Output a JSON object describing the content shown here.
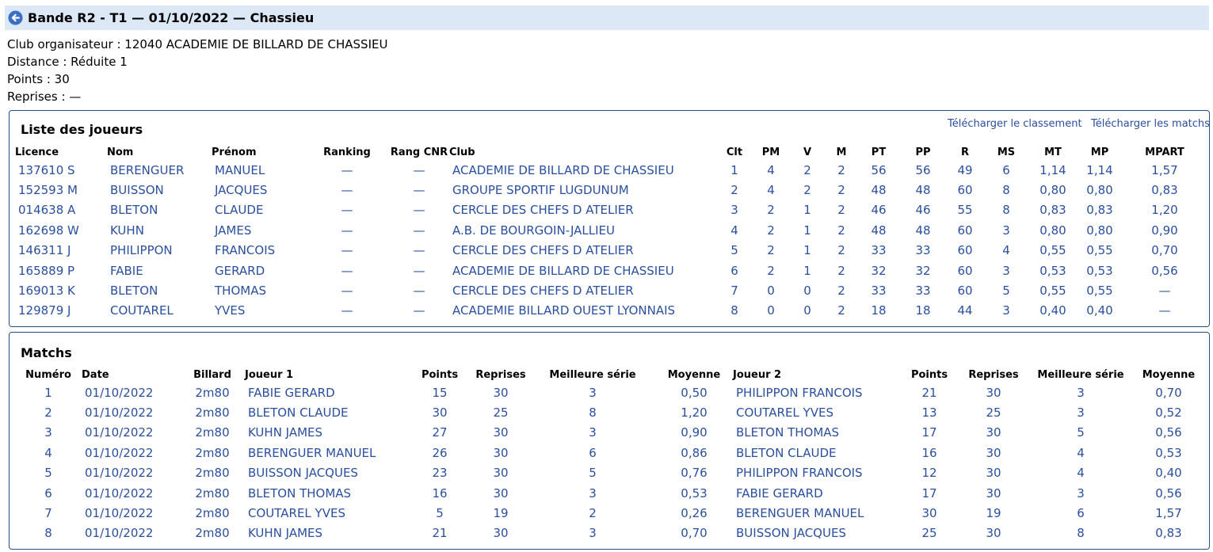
{
  "header": {
    "title": "Bande R2 - T1 — 01/10/2022 — Chassieu"
  },
  "info": {
    "club": "Club organisateur : 12040 ACADEMIE DE BILLARD DE CHASSIEU",
    "distance": "Distance : Réduite 1",
    "points": "Points : 30",
    "reprises": "Reprises : —"
  },
  "players": {
    "title": "Liste des joueurs",
    "download_ranking": "Télécharger le classement",
    "download_matches": "Télécharger les matchs",
    "columns": [
      "Licence",
      "Nom",
      "Prénom",
      "Ranking",
      "Rang CNR",
      "Club",
      "Clt",
      "PM",
      "V",
      "M",
      "PT",
      "PP",
      "R",
      "MS",
      "MT",
      "MP",
      "MPART"
    ],
    "rows": [
      [
        "137610 S",
        "BERENGUER",
        "MANUEL",
        "—",
        "—",
        "ACADEMIE DE BILLARD DE CHASSIEU",
        "1",
        "4",
        "2",
        "2",
        "56",
        "56",
        "49",
        "6",
        "1,14",
        "1,14",
        "1,57"
      ],
      [
        "152593 M",
        "BUISSON",
        "JACQUES",
        "—",
        "—",
        "GROUPE SPORTIF LUGDUNUM",
        "2",
        "4",
        "2",
        "2",
        "48",
        "48",
        "60",
        "8",
        "0,80",
        "0,80",
        "0,83"
      ],
      [
        "014638 A",
        "BLETON",
        "CLAUDE",
        "—",
        "—",
        "CERCLE DES CHEFS D ATELIER",
        "3",
        "2",
        "1",
        "2",
        "46",
        "46",
        "55",
        "8",
        "0,83",
        "0,83",
        "1,20"
      ],
      [
        "162698 W",
        "KUHN",
        "JAMES",
        "—",
        "—",
        "A.B. DE BOURGOIN-JALLIEU",
        "4",
        "2",
        "1",
        "2",
        "48",
        "48",
        "60",
        "3",
        "0,80",
        "0,80",
        "0,90"
      ],
      [
        "146311 J",
        "PHILIPPON",
        "FRANCOIS",
        "—",
        "—",
        "CERCLE DES CHEFS D ATELIER",
        "5",
        "2",
        "1",
        "2",
        "33",
        "33",
        "60",
        "4",
        "0,55",
        "0,55",
        "0,70"
      ],
      [
        "165889 P",
        "FABIE",
        "GERARD",
        "—",
        "—",
        "ACADEMIE DE BILLARD DE CHASSIEU",
        "6",
        "2",
        "1",
        "2",
        "32",
        "32",
        "60",
        "3",
        "0,53",
        "0,53",
        "0,56"
      ],
      [
        "169013 K",
        "BLETON",
        "THOMAS",
        "—",
        "—",
        "CERCLE DES CHEFS D ATELIER",
        "7",
        "0",
        "0",
        "2",
        "33",
        "33",
        "60",
        "5",
        "0,55",
        "0,55",
        "—"
      ],
      [
        "129879 J",
        "COUTAREL",
        "YVES",
        "—",
        "—",
        "ACADEMIE BILLARD OUEST LYONNAIS",
        "8",
        "0",
        "0",
        "2",
        "18",
        "18",
        "44",
        "3",
        "0,40",
        "0,40",
        "—"
      ]
    ]
  },
  "matches": {
    "title": "Matchs",
    "columns": [
      "Numéro",
      "Date",
      "Billard",
      "Joueur 1",
      "Points",
      "Reprises",
      "Meilleure série",
      "Moyenne",
      "Joueur 2",
      "Points",
      "Reprises",
      "Meilleure série",
      "Moyenne"
    ],
    "rows": [
      [
        "1",
        "01/10/2022",
        "2m80",
        "FABIE GERARD",
        "15",
        "30",
        "3",
        "0,50",
        "PHILIPPON FRANCOIS",
        "21",
        "30",
        "3",
        "0,70"
      ],
      [
        "2",
        "01/10/2022",
        "2m80",
        "BLETON CLAUDE",
        "30",
        "25",
        "8",
        "1,20",
        "COUTAREL YVES",
        "13",
        "25",
        "3",
        "0,52"
      ],
      [
        "3",
        "01/10/2022",
        "2m80",
        "KUHN JAMES",
        "27",
        "30",
        "3",
        "0,90",
        "BLETON THOMAS",
        "17",
        "30",
        "5",
        "0,56"
      ],
      [
        "4",
        "01/10/2022",
        "2m80",
        "BERENGUER MANUEL",
        "26",
        "30",
        "6",
        "0,86",
        "BLETON CLAUDE",
        "16",
        "30",
        "4",
        "0,53"
      ],
      [
        "5",
        "01/10/2022",
        "2m80",
        "BUISSON JACQUES",
        "23",
        "30",
        "5",
        "0,76",
        "PHILIPPON FRANCOIS",
        "12",
        "30",
        "4",
        "0,40"
      ],
      [
        "6",
        "01/10/2022",
        "2m80",
        "BLETON THOMAS",
        "16",
        "30",
        "3",
        "0,53",
        "FABIE GERARD",
        "17",
        "30",
        "3",
        "0,56"
      ],
      [
        "7",
        "01/10/2022",
        "2m80",
        "COUTAREL YVES",
        "5",
        "19",
        "2",
        "0,26",
        "BERENGUER MANUEL",
        "30",
        "19",
        "6",
        "1,57"
      ],
      [
        "8",
        "01/10/2022",
        "2m80",
        "KUHN JAMES",
        "21",
        "30",
        "3",
        "0,70",
        "BUISSON JACQUES",
        "25",
        "30",
        "8",
        "0,83"
      ]
    ]
  },
  "colors": {
    "link": "#2a4f9e",
    "header_bg": "#dde8f7",
    "border": "#2a4f7e"
  }
}
